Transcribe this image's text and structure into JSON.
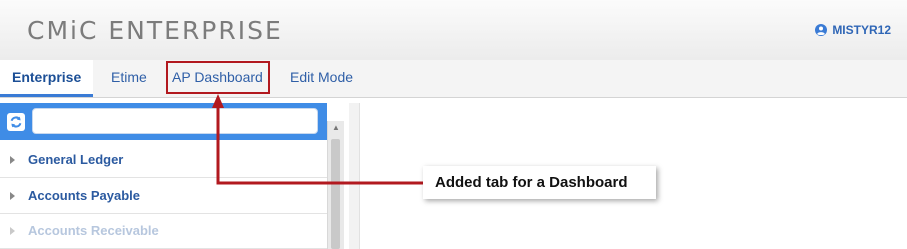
{
  "header": {
    "app_title": "CMiC ENTERPRISE",
    "username": "MISTYR12",
    "user_icon": "user-circle-icon"
  },
  "tabs": [
    {
      "label": "Enterprise",
      "active": true
    },
    {
      "label": "Etime",
      "active": false
    },
    {
      "label": "AP Dashboard",
      "active": false,
      "highlighted": true
    },
    {
      "label": "Edit Mode",
      "active": false
    }
  ],
  "sidebar": {
    "search_placeholder": "",
    "refresh_icon": "refresh-icon",
    "items": [
      {
        "label": "General Ledger"
      },
      {
        "label": "Accounts Payable"
      },
      {
        "label": "Accounts Receivable"
      }
    ]
  },
  "annotation": {
    "text": "Added tab for a Dashboard",
    "color": "#b2191f"
  },
  "colors": {
    "accent": "#3f8ce6",
    "link": "#2b5aa0",
    "highlight": "#b2191f"
  }
}
